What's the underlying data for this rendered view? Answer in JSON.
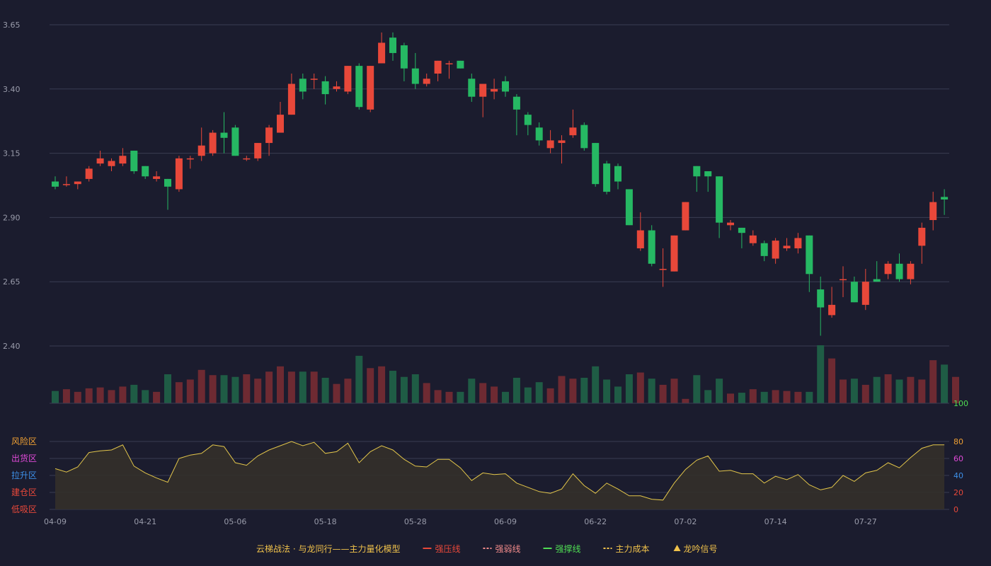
{
  "colors": {
    "background": "#1b1c2e",
    "grid": "#3a3c52",
    "up": "#e8483a",
    "down": "#26b863",
    "vol_up": "#6e2a32",
    "vol_down": "#1f5c45",
    "osc_line": "#e3c64a",
    "osc_fill": "#34302a",
    "axis_text": "#9a9cab"
  },
  "chart_data": [
    {
      "type": "candlestick",
      "price_ticks": [
        3.65,
        3.4,
        3.15,
        2.9,
        2.65,
        2.4
      ],
      "ylim": [
        2.4,
        3.65
      ],
      "candles": [
        [
          3.04,
          3.02,
          3.06,
          3.01
        ],
        [
          3.03,
          3.03,
          3.06,
          3.02
        ],
        [
          3.03,
          3.04,
          3.04,
          3.01
        ],
        [
          3.05,
          3.09,
          3.1,
          3.04
        ],
        [
          3.11,
          3.13,
          3.16,
          3.1
        ],
        [
          3.1,
          3.12,
          3.13,
          3.08
        ],
        [
          3.11,
          3.14,
          3.17,
          3.1
        ],
        [
          3.16,
          3.08,
          3.16,
          3.07
        ],
        [
          3.1,
          3.06,
          3.1,
          3.05
        ],
        [
          3.05,
          3.06,
          3.08,
          3.04
        ],
        [
          3.05,
          3.02,
          3.05,
          2.93
        ],
        [
          3.01,
          3.13,
          3.14,
          3.0
        ],
        [
          3.13,
          3.13,
          3.14,
          3.09
        ],
        [
          3.14,
          3.18,
          3.25,
          3.12
        ],
        [
          3.15,
          3.23,
          3.24,
          3.14
        ],
        [
          3.23,
          3.21,
          3.31,
          3.15
        ],
        [
          3.25,
          3.14,
          3.26,
          3.14
        ],
        [
          3.13,
          3.13,
          3.14,
          3.12
        ],
        [
          3.13,
          3.19,
          3.19,
          3.12
        ],
        [
          3.19,
          3.25,
          3.26,
          3.14
        ],
        [
          3.23,
          3.3,
          3.35,
          3.23
        ],
        [
          3.3,
          3.42,
          3.46,
          3.3
        ],
        [
          3.44,
          3.39,
          3.46,
          3.36
        ],
        [
          3.44,
          3.44,
          3.46,
          3.4
        ],
        [
          3.43,
          3.38,
          3.45,
          3.34
        ],
        [
          3.4,
          3.41,
          3.43,
          3.39
        ],
        [
          3.39,
          3.49,
          3.49,
          3.38
        ],
        [
          3.49,
          3.33,
          3.5,
          3.32
        ],
        [
          3.32,
          3.49,
          3.49,
          3.31
        ],
        [
          3.5,
          3.58,
          3.62,
          3.5
        ],
        [
          3.6,
          3.54,
          3.62,
          3.51
        ],
        [
          3.57,
          3.48,
          3.58,
          3.43
        ],
        [
          3.48,
          3.42,
          3.54,
          3.4
        ],
        [
          3.42,
          3.44,
          3.46,
          3.41
        ],
        [
          3.46,
          3.51,
          3.51,
          3.43
        ],
        [
          3.5,
          3.5,
          3.51,
          3.44
        ],
        [
          3.51,
          3.48,
          3.51,
          3.48
        ],
        [
          3.44,
          3.37,
          3.46,
          3.35
        ],
        [
          3.37,
          3.42,
          3.42,
          3.29
        ],
        [
          3.39,
          3.4,
          3.44,
          3.36
        ],
        [
          3.43,
          3.39,
          3.45,
          3.37
        ],
        [
          3.37,
          3.32,
          3.38,
          3.22
        ],
        [
          3.3,
          3.26,
          3.31,
          3.22
        ],
        [
          3.25,
          3.2,
          3.27,
          3.18
        ],
        [
          3.17,
          3.2,
          3.24,
          3.15
        ],
        [
          3.19,
          3.2,
          3.22,
          3.11
        ],
        [
          3.22,
          3.25,
          3.32,
          3.21
        ],
        [
          3.26,
          3.17,
          3.27,
          3.16
        ],
        [
          3.19,
          3.03,
          3.19,
          3.02
        ],
        [
          3.11,
          3.0,
          3.12,
          2.99
        ],
        [
          3.1,
          3.04,
          3.11,
          3.01
        ],
        [
          3.01,
          2.87,
          3.01,
          2.87
        ],
        [
          2.78,
          2.85,
          2.92,
          2.77
        ],
        [
          2.85,
          2.72,
          2.87,
          2.71
        ],
        [
          2.7,
          2.7,
          2.78,
          2.63
        ],
        [
          2.69,
          2.83,
          2.83,
          2.69
        ],
        [
          2.85,
          2.96,
          2.96,
          2.85
        ],
        [
          3.1,
          3.06,
          3.1,
          3.0
        ],
        [
          3.08,
          3.06,
          3.08,
          3.0
        ],
        [
          3.06,
          2.88,
          3.06,
          2.82
        ],
        [
          2.87,
          2.88,
          2.89,
          2.85
        ],
        [
          2.86,
          2.84,
          2.86,
          2.78
        ],
        [
          2.8,
          2.83,
          2.85,
          2.79
        ],
        [
          2.8,
          2.75,
          2.81,
          2.73
        ],
        [
          2.74,
          2.81,
          2.82,
          2.72
        ],
        [
          2.78,
          2.79,
          2.82,
          2.77
        ],
        [
          2.78,
          2.82,
          2.84,
          2.76
        ],
        [
          2.83,
          2.68,
          2.83,
          2.61
        ],
        [
          2.62,
          2.55,
          2.67,
          2.44
        ],
        [
          2.52,
          2.56,
          2.63,
          2.51
        ],
        [
          2.66,
          2.66,
          2.71,
          2.59
        ],
        [
          2.65,
          2.57,
          2.67,
          2.57
        ],
        [
          2.56,
          2.65,
          2.7,
          2.54
        ],
        [
          2.66,
          2.65,
          2.73,
          2.65
        ],
        [
          2.68,
          2.72,
          2.73,
          2.66
        ],
        [
          2.72,
          2.66,
          2.76,
          2.65
        ],
        [
          2.66,
          2.72,
          2.73,
          2.64
        ],
        [
          2.79,
          2.86,
          2.88,
          2.72
        ],
        [
          2.89,
          2.96,
          3.0,
          2.85
        ],
        [
          2.98,
          2.97,
          3.01,
          2.91
        ]
      ],
      "volume": [
        14,
        16,
        13,
        17,
        18,
        15,
        19,
        21,
        15,
        13,
        33,
        24,
        27,
        38,
        32,
        32,
        30,
        33,
        28,
        36,
        42,
        36,
        36,
        36,
        29,
        22,
        28,
        54,
        40,
        42,
        37,
        30,
        33,
        23,
        15,
        13,
        13,
        28,
        23,
        19,
        13,
        29,
        18,
        24,
        17,
        31,
        28,
        29,
        42,
        27,
        19,
        33,
        35,
        28,
        21,
        28,
        5,
        32,
        15,
        28,
        11,
        12,
        16,
        13,
        15,
        14,
        13,
        13,
        66,
        51,
        27,
        28,
        21,
        30,
        33,
        27,
        30,
        27,
        49,
        44,
        30
      ],
      "x_ticks": [
        {
          "index": 0,
          "label": "04-09"
        },
        {
          "index": 8,
          "label": "04-21"
        },
        {
          "index": 16,
          "label": "05-06"
        },
        {
          "index": 24,
          "label": "05-18"
        },
        {
          "index": 32,
          "label": "05-28"
        },
        {
          "index": 40,
          "label": "06-09"
        },
        {
          "index": 48,
          "label": "06-22"
        },
        {
          "index": 56,
          "label": "07-02"
        },
        {
          "index": 64,
          "label": "07-14"
        },
        {
          "index": 72,
          "label": "07-27"
        }
      ]
    },
    {
      "type": "area",
      "osc_right_ticks": [
        100,
        80,
        60,
        40,
        20,
        0
      ],
      "osc_right_colors": [
        "#4fdc53",
        "#f0a033",
        "#e04ad8",
        "#3d8fe8",
        "#e8483a",
        "#e8483a"
      ],
      "ylim": [
        0,
        100
      ],
      "zones": [
        {
          "label": "风险区",
          "color": "#f0a033"
        },
        {
          "label": "出货区",
          "color": "#e04ad8"
        },
        {
          "label": "拉升区",
          "color": "#3d8fe8"
        },
        {
          "label": "建仓区",
          "color": "#e8483a"
        },
        {
          "label": "低吸区",
          "color": "#e8483a"
        }
      ],
      "values": [
        48,
        44,
        50,
        67,
        69,
        70,
        76,
        51,
        43,
        37,
        32,
        60,
        64,
        66,
        76,
        74,
        55,
        52,
        63,
        70,
        75,
        80,
        75,
        79,
        66,
        68,
        78,
        55,
        68,
        75,
        70,
        59,
        51,
        50,
        59,
        59,
        49,
        34,
        43,
        41,
        42,
        31,
        26,
        21,
        19,
        24,
        42,
        28,
        19,
        31,
        24,
        16,
        16,
        12,
        11,
        31,
        47,
        58,
        63,
        45,
        46,
        42,
        42,
        31,
        39,
        35,
        41,
        29,
        23,
        26,
        40,
        33,
        43,
        46,
        55,
        49,
        61,
        72,
        76,
        76
      ]
    }
  ],
  "legend": {
    "title": "云梯战法 · 与龙同行——主力量化模型",
    "items": [
      {
        "label": "强压线",
        "color": "#e8483a",
        "style": "solid"
      },
      {
        "label": "强弱线",
        "color": "#f08a8a",
        "style": "dashed"
      },
      {
        "label": "强撑线",
        "color": "#4fdc53",
        "style": "solid"
      },
      {
        "label": "主力成本",
        "color": "#f0c24b",
        "style": "dashed"
      },
      {
        "label": "龙吟信号",
        "color": "#f0c24b",
        "style": "triangle"
      }
    ]
  }
}
